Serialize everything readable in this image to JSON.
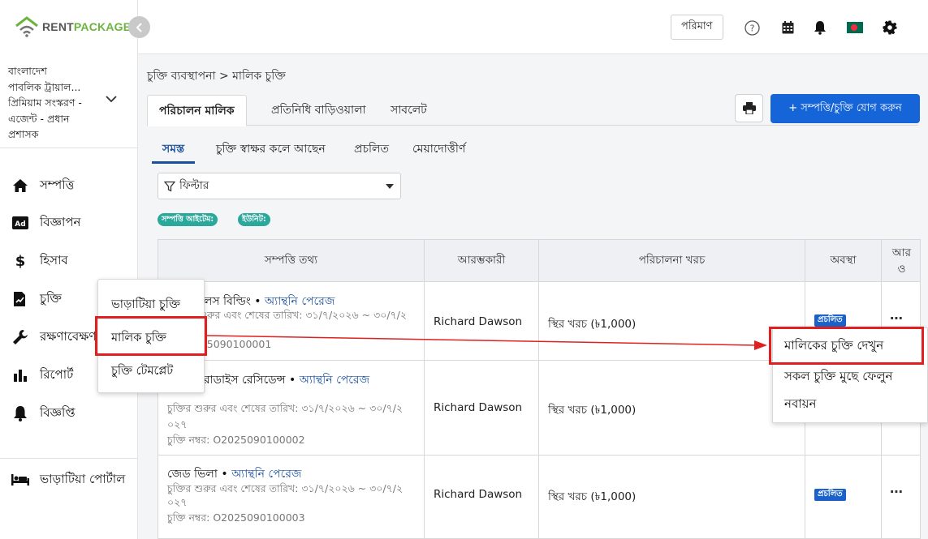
{
  "app": {
    "logo_part1": "RENT",
    "logo_part2": "PACKAGE"
  },
  "account": {
    "line1": "বাংলাদেশ",
    "line2": "পাবলিক ট্রায়াল...",
    "line3": "প্রিমিয়াম সংস্করণ -",
    "line4": "এজেন্ট - প্রধান",
    "line5": "প্রশাসক"
  },
  "sidebar": {
    "items": [
      {
        "label": "সম্পত্তি",
        "icon": "home-icon"
      },
      {
        "label": "বিজ্ঞাপন",
        "icon": "ad-icon"
      },
      {
        "label": "হিসাব",
        "icon": "dollar-icon"
      },
      {
        "label": "চুক্তি",
        "icon": "contract-icon"
      },
      {
        "label": "রক্ষণাবেক্ষণ",
        "icon": "wrench-icon"
      },
      {
        "label": "রিপোর্ট",
        "icon": "bar-chart-icon"
      },
      {
        "label": "বিজ্ঞপ্তি",
        "icon": "bell-icon"
      }
    ],
    "tenant_portal": "ভাড়াটিয়া পোর্টাল"
  },
  "topbar": {
    "quantity_label": "পরিমাণ"
  },
  "breadcrumb": "চুক্তি ব্যবস্থাপনা > মালিক চুক্তি",
  "tabs": [
    {
      "label": "পরিচালন মালিক"
    },
    {
      "label": "প্রতিনিধি বাড়িওয়ালা"
    },
    {
      "label": "সাবলেট"
    }
  ],
  "add_button": "+ সম্পত্তি/চুক্তি যোগ করুন",
  "subtabs": [
    {
      "label": "সমস্ত"
    },
    {
      "label": "চুক্তি স্বাক্ষর কলে আছেন"
    },
    {
      "label": "প্রচলিত"
    },
    {
      "label": "মেয়াদোত্তীর্ণ"
    }
  ],
  "filter": {
    "label": "ফিল্টার"
  },
  "chips": [
    {
      "label": "সম্পত্তি আইটেম:"
    },
    {
      "label": "ইউনিট:"
    }
  ],
  "table": {
    "headers": [
      "সম্পত্তি তথ্য",
      "আরম্ভকারী",
      "পরিচালনা খরচ",
      "অবস্থা",
      "আর ও"
    ],
    "rows": [
      {
        "title": "া প্যালেস বিল্ডিং",
        "owner": "অ্যান্থনি পেরেজ",
        "date_line": "ুক্তির শুরুর এবং শেষের তারিখ: ৩১/৭/২০২৬ ~ ৩০/৭/২",
        "date_line2": "",
        "contract_no": "র: O2025090100001",
        "initiator": "Richard Dawson",
        "cost": "স্থির খরচ (৳1,000)",
        "status": "প্রচলিত"
      },
      {
        "title": "ো প্যারাডাইস রেসিডেন্স",
        "owner": "অ্যান্থনি পেরেজ",
        "date_line": "চুক্তির শুরুর এবং শেষের তারিখ: ৩১/৭/২০২৬ ~ ৩০/৭/২",
        "date_line2": "০২৭",
        "contract_no": "চুক্তি নম্বর: O2025090100002",
        "initiator": "Richard Dawson",
        "cost": "স্থির খরচ (৳1,000)",
        "status": ""
      },
      {
        "title": "জেড ভিলা",
        "owner": "অ্যান্থনি পেরেজ",
        "date_line": "চুক্তির শুরুর এবং শেষের তারিখ: ৩১/৭/২০২৬ ~ ৩০/৭/২",
        "date_line2": "০২৭",
        "contract_no": "চুক্তি নম্বর: O2025090100003",
        "initiator": "Richard Dawson",
        "cost": "স্থির খরচ (৳1,000)",
        "status": "প্রচলিত"
      }
    ]
  },
  "contract_submenu": [
    {
      "label": "ভাড়াটিয়া চুক্তি"
    },
    {
      "label": "মালিক চুক্তি"
    },
    {
      "label": "চুক্তি টেমপ্লেট"
    }
  ],
  "action_menu": [
    {
      "label": "মালিকের চুক্তি দেখুন"
    },
    {
      "label": "সকল চুক্তি মুছে ফেলুন"
    },
    {
      "label": "নবায়ন"
    }
  ],
  "colors": {
    "primary": "#1565d8",
    "brand_green": "#6cb33f",
    "chip": "#2aa89b",
    "highlight": "#e02020"
  }
}
